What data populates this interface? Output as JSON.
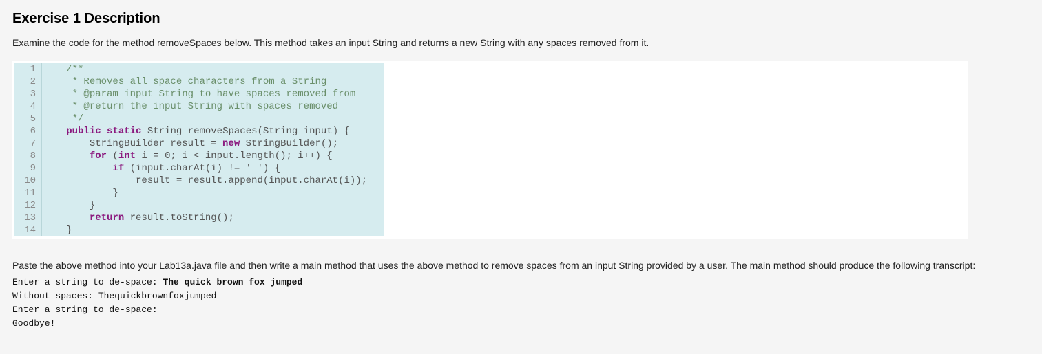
{
  "heading": "Exercise 1 Description",
  "intro": "Examine the code for the method removeSpaces below.  This method takes an input String and returns a new String with any spaces removed from it.",
  "code": {
    "lines": [
      {
        "n": 1,
        "indent": "   ",
        "segments": [
          {
            "t": "/**",
            "cls": "cm"
          }
        ]
      },
      {
        "n": 2,
        "indent": "    ",
        "segments": [
          {
            "t": "* Removes all space characters from a String",
            "cls": "cm"
          }
        ]
      },
      {
        "n": 3,
        "indent": "    ",
        "segments": [
          {
            "t": "* @param input String to have spaces removed from",
            "cls": "cm"
          }
        ]
      },
      {
        "n": 4,
        "indent": "    ",
        "segments": [
          {
            "t": "* @return the input String with spaces removed",
            "cls": "cm"
          }
        ]
      },
      {
        "n": 5,
        "indent": "    ",
        "segments": [
          {
            "t": "*/",
            "cls": "cm"
          }
        ]
      },
      {
        "n": 6,
        "indent": "   ",
        "segments": [
          {
            "t": "public",
            "cls": "kw"
          },
          {
            "t": " "
          },
          {
            "t": "static",
            "cls": "kw"
          },
          {
            "t": " String removeSpaces(String input) {",
            "cls": "fn"
          }
        ]
      },
      {
        "n": 7,
        "indent": "       ",
        "segments": [
          {
            "t": "StringBuilder result = ",
            "cls": "fn"
          },
          {
            "t": "new",
            "cls": "kw"
          },
          {
            "t": " StringBuilder();",
            "cls": "fn"
          }
        ]
      },
      {
        "n": 8,
        "indent": "       ",
        "segments": [
          {
            "t": "for",
            "cls": "kw"
          },
          {
            "t": " (",
            "cls": "fn"
          },
          {
            "t": "int",
            "cls": "kw"
          },
          {
            "t": " i = 0; i < input.length(); i++) {",
            "cls": "fn"
          }
        ]
      },
      {
        "n": 9,
        "indent": "           ",
        "segments": [
          {
            "t": "if",
            "cls": "kw"
          },
          {
            "t": " (input.charAt(i) != ' ') {",
            "cls": "fn"
          }
        ]
      },
      {
        "n": 10,
        "indent": "               ",
        "segments": [
          {
            "t": "result = result.append(input.charAt(i));",
            "cls": "fn"
          }
        ]
      },
      {
        "n": 11,
        "indent": "           ",
        "segments": [
          {
            "t": "}",
            "cls": "fn"
          }
        ]
      },
      {
        "n": 12,
        "indent": "       ",
        "segments": [
          {
            "t": "}",
            "cls": "fn"
          }
        ]
      },
      {
        "n": 13,
        "indent": "       ",
        "segments": [
          {
            "t": "return",
            "cls": "kw"
          },
          {
            "t": " result.toString();",
            "cls": "fn"
          }
        ]
      },
      {
        "n": 14,
        "indent": "   ",
        "segments": [
          {
            "t": "}",
            "cls": "fn"
          }
        ]
      }
    ]
  },
  "instructions": "Paste the above method into your Lab13a.java file and then write a main method that uses the above method to remove spaces from an input String provided by a user. The main method should produce the following transcript:",
  "transcript": [
    {
      "prefix": "Enter a string to de-space: ",
      "bold": "The quick brown fox jumped"
    },
    {
      "prefix": "Without spaces: Thequickbrownfoxjumped",
      "bold": ""
    },
    {
      "prefix": "Enter a string to de-space:",
      "bold": ""
    },
    {
      "prefix": "Goodbye!",
      "bold": ""
    }
  ]
}
